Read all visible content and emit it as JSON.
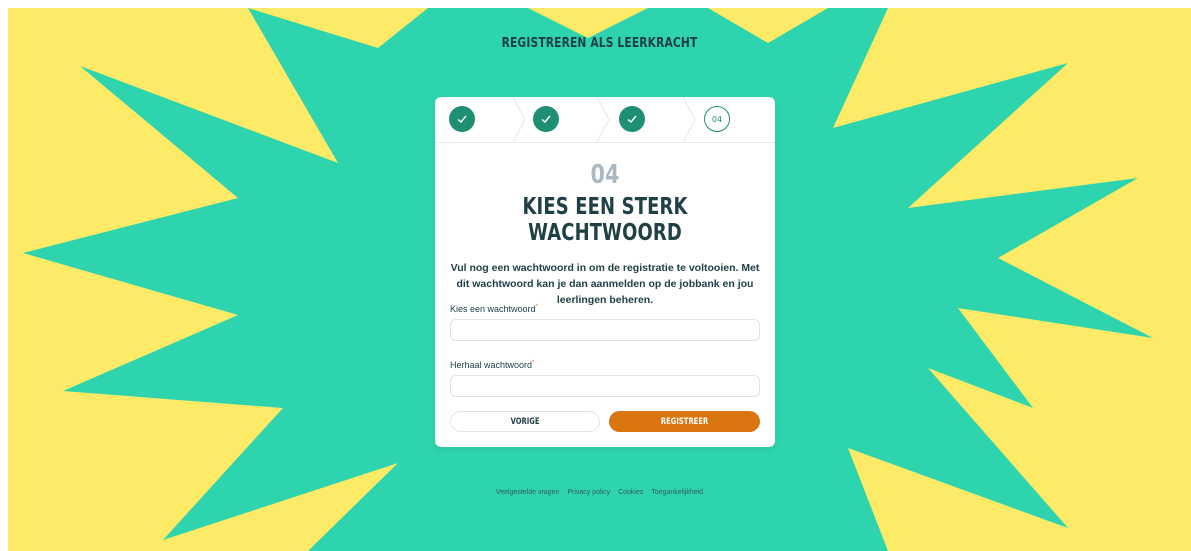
{
  "page": {
    "title": "REGISTREREN ALS LEERKRACHT",
    "colors": {
      "background": "#fdea66",
      "burst": "#2dd4ad",
      "accent": "#1f8f73",
      "primary_button": "#d9740f",
      "dark_text": "#1f4047"
    }
  },
  "stepper": {
    "steps": [
      {
        "state": "done",
        "icon": "check-icon"
      },
      {
        "state": "done",
        "icon": "check-icon"
      },
      {
        "state": "done",
        "icon": "check-icon"
      },
      {
        "state": "current",
        "label": "04"
      }
    ]
  },
  "form": {
    "step_number": "04",
    "heading": "KIES EEN STERK WACHTWOORD",
    "description": "Vul nog een wachtwoord in om de registratie te voltooien. Met dit wachtwoord kan je dan aanmelden op de jobbank en jou leerlingen beheren.",
    "password_label": "Kies een wachtwoord",
    "password_value": "",
    "repeat_label": "Herhaal wachtwoord",
    "repeat_value": "",
    "required_marker": "*",
    "prev_button": "VORIGE",
    "submit_button": "REGISTREER"
  },
  "footer": {
    "links": [
      "Veelgestelde vragen",
      "Privacy policy",
      "Cookies",
      "Toegankelijkheid"
    ]
  }
}
